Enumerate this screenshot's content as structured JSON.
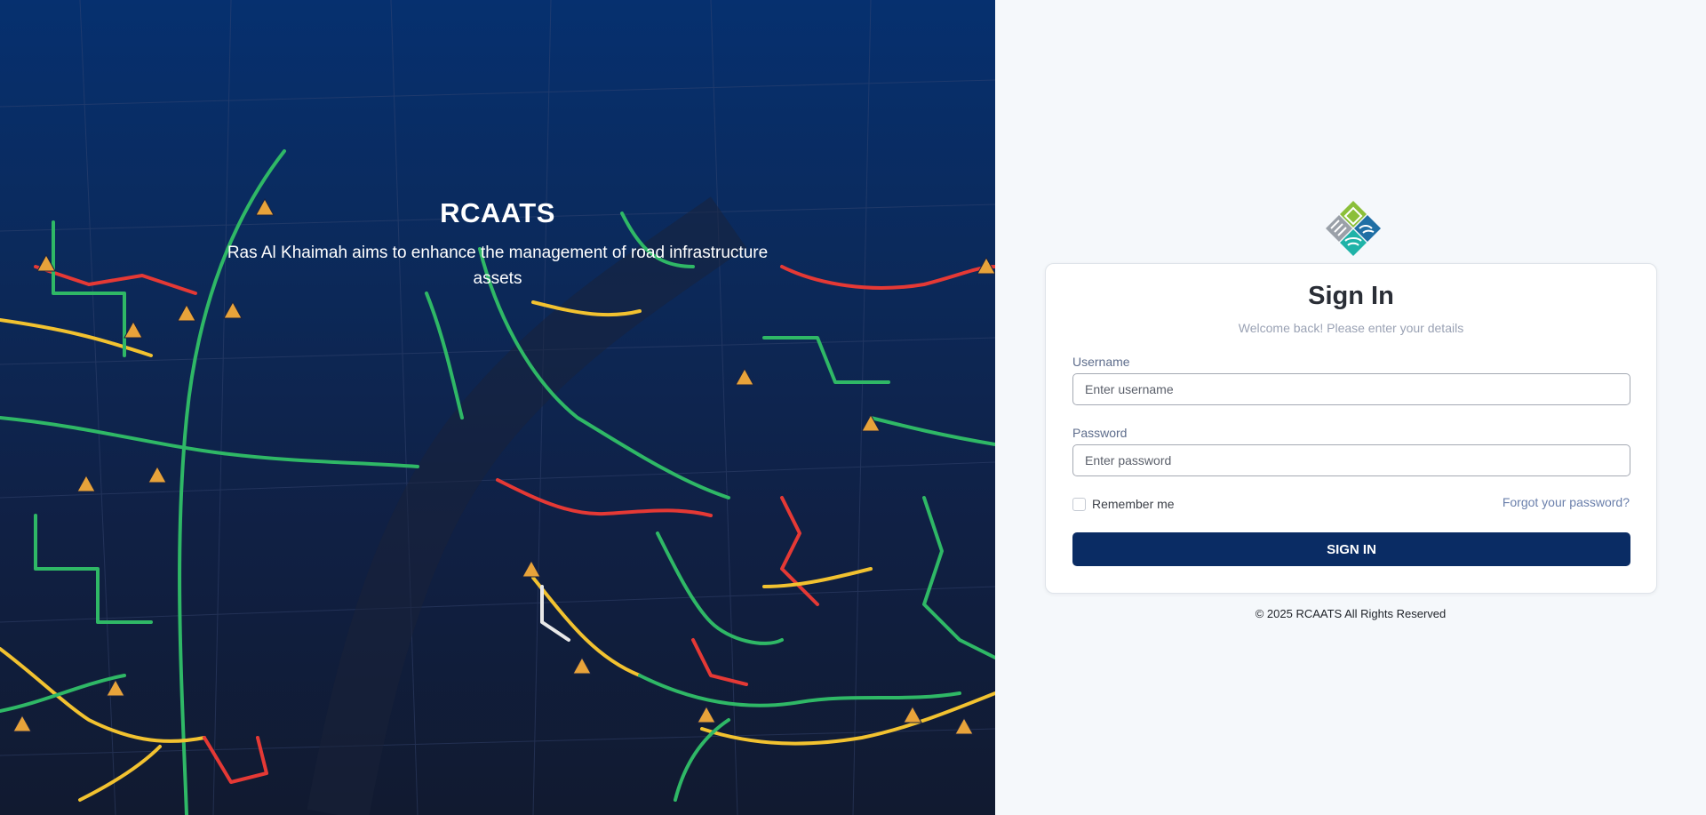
{
  "hero": {
    "title": "RCAATS",
    "subtitle": "Ras Al Khaimah aims to enhance the management of road infrastructure assets"
  },
  "logo": {
    "icon": "rcaats-diamond-logo-icon",
    "colors": [
      "#8bbf3a",
      "#9aa0a8",
      "#1f6fa5",
      "#1fb3a8"
    ]
  },
  "login": {
    "title": "Sign In",
    "subtitle": "Welcome back! Please enter your details",
    "username_label": "Username",
    "username_placeholder": "Enter username",
    "username_value": "",
    "password_label": "Password",
    "password_placeholder": "Enter password",
    "password_value": "",
    "remember_label": "Remember me",
    "remember_checked": false,
    "forgot_label": "Forgot your password?",
    "submit_label": "SIGN IN"
  },
  "footer": {
    "copyright": "© 2025 RCAATS All Rights Reserved"
  },
  "colors": {
    "primary": "#0a2c64",
    "link": "#6a7fab",
    "traffic_good": "#2fb866",
    "traffic_moderate": "#f2c230",
    "traffic_heavy": "#e53935",
    "alert": "#e8a33a"
  }
}
